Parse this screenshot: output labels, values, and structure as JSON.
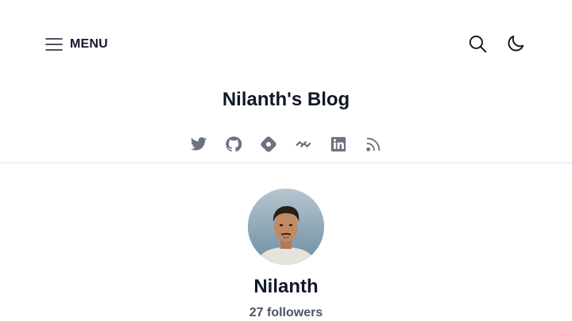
{
  "header": {
    "menu_label": "MENU",
    "menu_icon": "hamburger-icon",
    "search_icon": "search-icon",
    "theme_icon": "moon-icon",
    "blog_title": "Nilanth's Blog"
  },
  "socials": [
    {
      "name": "twitter-icon"
    },
    {
      "name": "github-icon"
    },
    {
      "name": "hashnode-icon"
    },
    {
      "name": "devto-icon"
    },
    {
      "name": "linkedin-icon"
    },
    {
      "name": "rss-icon"
    }
  ],
  "profile": {
    "name": "Nilanth",
    "followers": "27 followers"
  },
  "colors": {
    "text": "#111827",
    "muted": "#4b5563",
    "icon": "#6b7280",
    "border": "#e5e7eb"
  }
}
